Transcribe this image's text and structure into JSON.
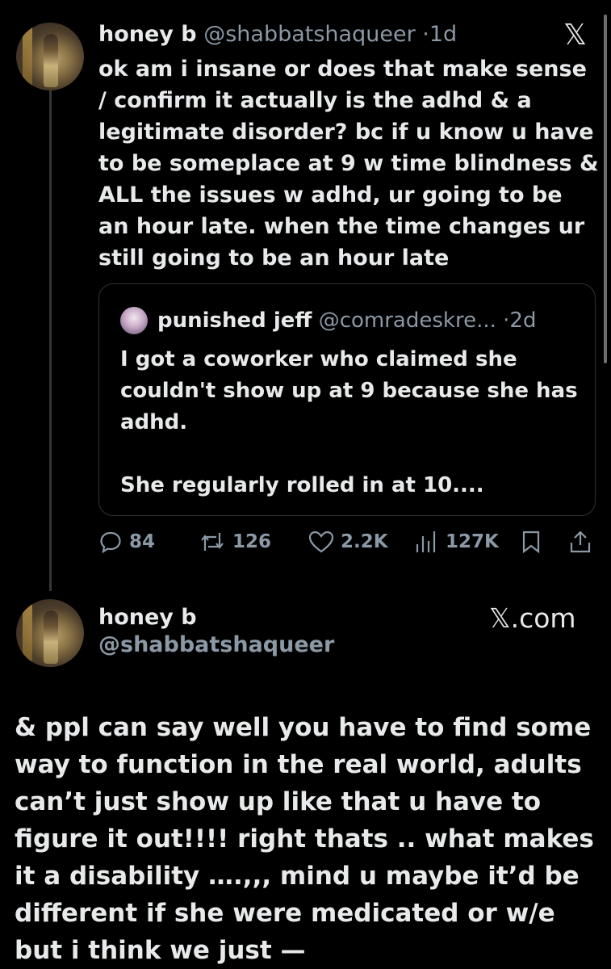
{
  "tweet": {
    "display_name": "honey b",
    "handle": "@shabbatshaqueer",
    "separator": "·",
    "time": "1d",
    "close_label": "𝕏",
    "body": "ok am i insane or does that make sense / confirm it actually is the adhd & a legitimate disorder? bc if u know u have to be someplace at 9 w time blindness & ALL the issues w adhd, ur going to be an hour late. when the time changes ur still going to be an hour late",
    "quote": {
      "display_name": "punished jeff",
      "handle": "@comradeskre...",
      "separator": "·",
      "time": "2d",
      "body": "I got a coworker who claimed she couldn't show up at 9 because she has adhd.\n\nShe regularly rolled in at 10...."
    },
    "actions": {
      "replies": "84",
      "retweets": "126",
      "likes": "2.2K",
      "views": "127K"
    }
  },
  "reply_card": {
    "display_name": "honey b",
    "handle": "@shabbatshaqueer",
    "brand": "𝕏.com",
    "body": "& ppl can say well you have to find some way to function in the real world, adults can’t just show up like that u have to figure it out!!!! right thats .. what makes it a disability ….,,, mind u maybe it’d be different if she were medicated or w/e but i think we just —"
  }
}
